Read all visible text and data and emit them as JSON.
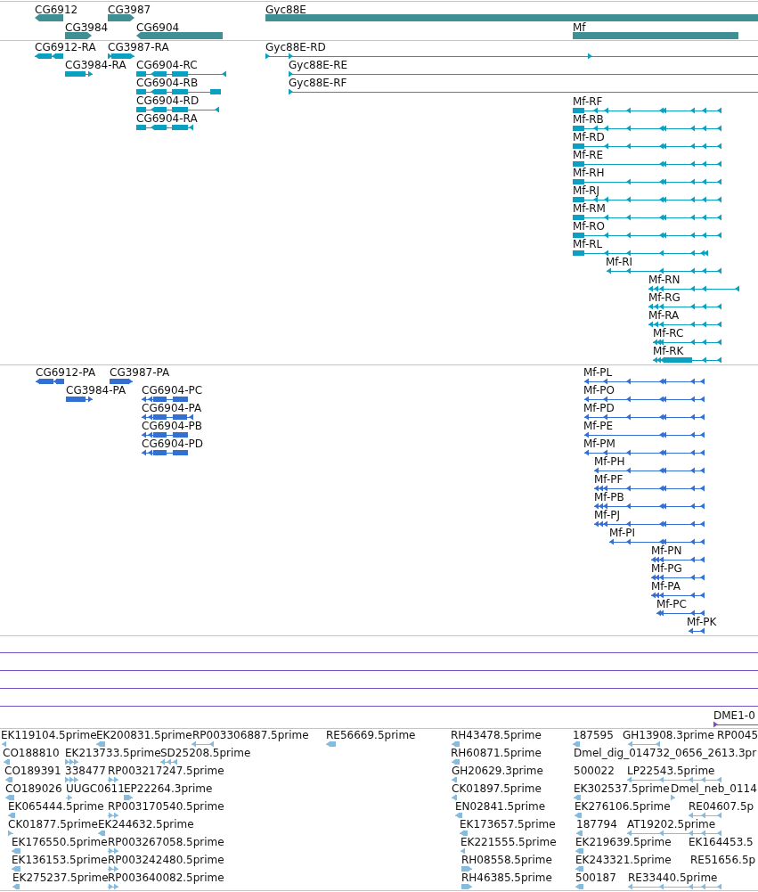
{
  "tracks": [
    {
      "kind": "genes",
      "color": "#3f8f94",
      "features": [
        {
          "label": "CG6912"
        },
        {
          "label": "CG3987"
        },
        {
          "label": "Gyc88E"
        },
        {
          "label": "CG3984"
        },
        {
          "label": "CG6904"
        },
        {
          "label": "Mf"
        }
      ]
    },
    {
      "kind": "transcripts",
      "color": "#0aa0c2",
      "features": [
        {
          "label": "CG6912-RA"
        },
        {
          "label": "CG3987-RA"
        },
        {
          "label": "Gyc88E-RD"
        },
        {
          "label": "CG3984-RA"
        },
        {
          "label": "CG6904-RC"
        },
        {
          "label": "Gyc88E-RE"
        },
        {
          "label": "CG6904-RB"
        },
        {
          "label": "Gyc88E-RF"
        },
        {
          "label": "CG6904-RD"
        },
        {
          "label": "Mf-RF"
        },
        {
          "label": "CG6904-RA"
        },
        {
          "label": "Mf-RB"
        },
        {
          "label": "Mf-RD"
        },
        {
          "label": "Mf-RE"
        },
        {
          "label": "Mf-RH"
        },
        {
          "label": "Mf-RJ"
        },
        {
          "label": "Mf-RM"
        },
        {
          "label": "Mf-RO"
        },
        {
          "label": "Mf-RL"
        },
        {
          "label": "Mf-RI"
        },
        {
          "label": "Mf-RN"
        },
        {
          "label": "Mf-RG"
        },
        {
          "label": "Mf-RA"
        },
        {
          "label": "Mf-RC"
        },
        {
          "label": "Mf-RK"
        }
      ]
    },
    {
      "kind": "proteins",
      "color": "#3370d2",
      "features": [
        {
          "label": "CG6912-PA"
        },
        {
          "label": "CG3987-PA"
        },
        {
          "label": "Mf-PL"
        },
        {
          "label": "CG3984-PA"
        },
        {
          "label": "CG6904-PC"
        },
        {
          "label": "Mf-PO"
        },
        {
          "label": "CG6904-PA"
        },
        {
          "label": "Mf-PD"
        },
        {
          "label": "CG6904-PB"
        },
        {
          "label": "Mf-PE"
        },
        {
          "label": "CG6904-PD"
        },
        {
          "label": "Mf-PM"
        },
        {
          "label": "Mf-PH"
        },
        {
          "label": "Mf-PF"
        },
        {
          "label": "Mf-PB"
        },
        {
          "label": "Mf-PJ"
        },
        {
          "label": "Mf-PI"
        },
        {
          "label": "Mf-PN"
        },
        {
          "label": "Mf-PG"
        },
        {
          "label": "Mf-PA"
        },
        {
          "label": "Mf-PC"
        },
        {
          "label": "Mf-PK"
        }
      ]
    },
    {
      "kind": "regions",
      "color": "#7452c2",
      "features": [
        {
          "label": "DME1-0"
        }
      ]
    },
    {
      "kind": "ests",
      "color": "#86bbe0",
      "features": [
        {
          "label": "EK119104.5prime"
        },
        {
          "label": "EK200831.5prime"
        },
        {
          "label": "RP003306887.5prime"
        },
        {
          "label": "RE56669.5prime"
        },
        {
          "label": "RH43478.5prime"
        },
        {
          "label": "187595"
        },
        {
          "label": "GH13908.3prime"
        },
        {
          "label": "RP0045"
        },
        {
          "label": "CO188810"
        },
        {
          "label": "EK213733.5prime"
        },
        {
          "label": "SD25208.5prime"
        },
        {
          "label": "RH60871.5prime"
        },
        {
          "label": "Dmel_dig_014732_0656_2613.3pr"
        },
        {
          "label": "CO189391"
        },
        {
          "label": "338477"
        },
        {
          "label": "RP003217247.5prime"
        },
        {
          "label": "GH20629.3prime"
        },
        {
          "label": "500022"
        },
        {
          "label": "LP22543.5prime"
        },
        {
          "label": "CO189026"
        },
        {
          "label": "UUGC0611"
        },
        {
          "label": "EP22264.3prime"
        },
        {
          "label": "CK01897.5prime"
        },
        {
          "label": "EK302537.5prime"
        },
        {
          "label": "Dmel_neb_0114"
        },
        {
          "label": "EK065444.5prime"
        },
        {
          "label": "RP003170540.5prime"
        },
        {
          "label": "EN02841.5prime"
        },
        {
          "label": "EK276106.5prime"
        },
        {
          "label": "RE04607.5p"
        },
        {
          "label": "CK01877.5prime"
        },
        {
          "label": "EK244632.5prime"
        },
        {
          "label": "EK173657.5prime"
        },
        {
          "label": "187794"
        },
        {
          "label": "AT19202.5prime"
        },
        {
          "label": "EK176550.5prime"
        },
        {
          "label": "RP003267058.5prime"
        },
        {
          "label": "EK221555.5prime"
        },
        {
          "label": "EK219639.5prime"
        },
        {
          "label": "EK164453.5"
        },
        {
          "label": "EK136153.5prime"
        },
        {
          "label": "RP003242480.5prime"
        },
        {
          "label": "RH08558.5prime"
        },
        {
          "label": "EK243321.5prime"
        },
        {
          "label": "RE51656.5p"
        },
        {
          "label": "EK275237.5prime"
        },
        {
          "label": "RP003640082.5prime"
        },
        {
          "label": "RH46385.5prime"
        },
        {
          "label": "500187"
        },
        {
          "label": "RE33440.5prime"
        }
      ]
    }
  ]
}
